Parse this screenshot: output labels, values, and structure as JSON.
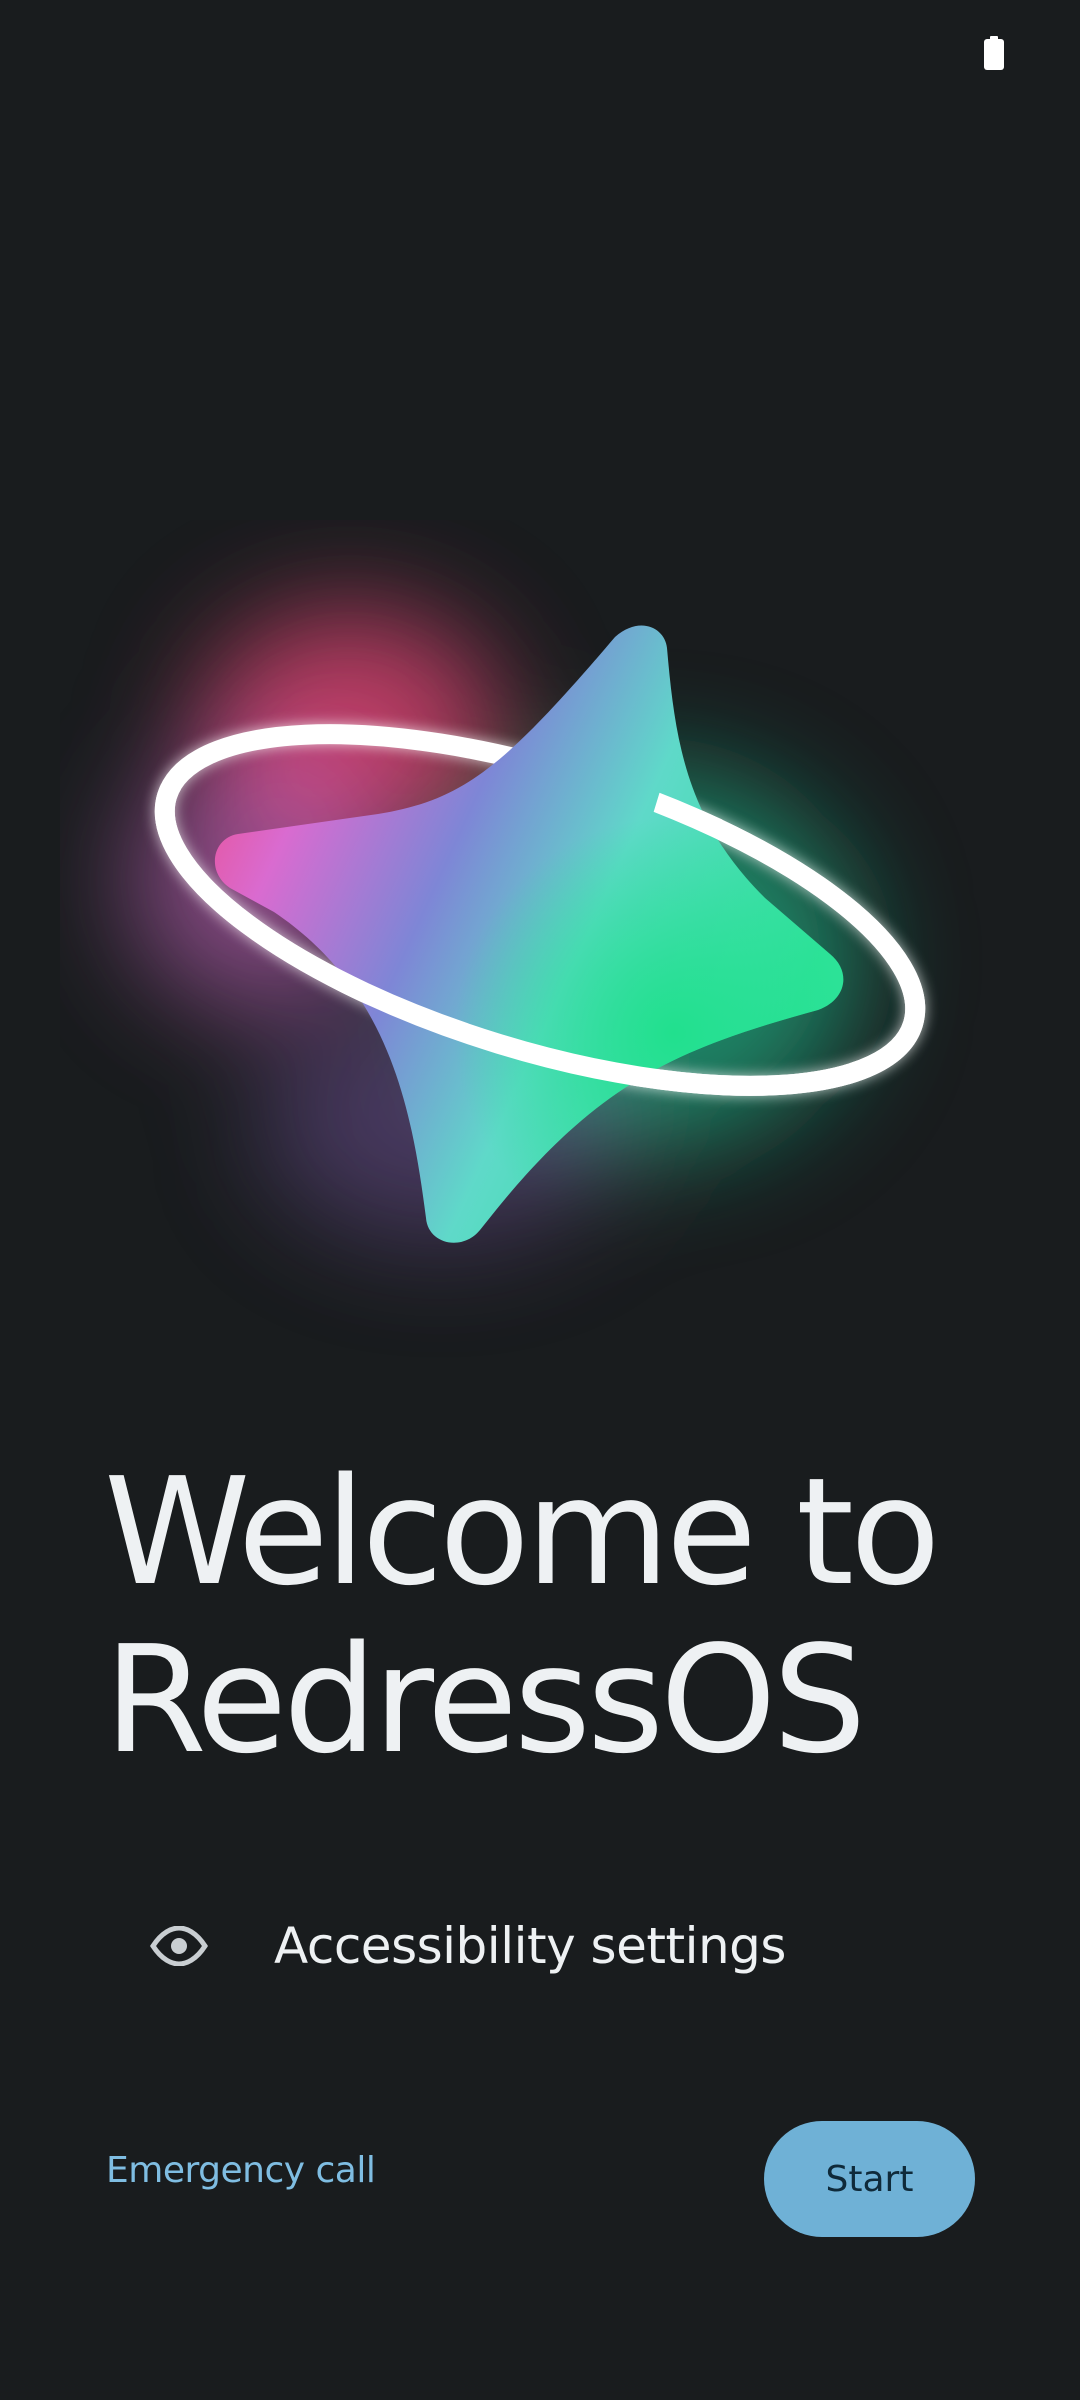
{
  "status_bar": {
    "battery_icon": "battery-full-icon"
  },
  "hero": {
    "illustration": "four-point-star-with-orbit-ring",
    "colors": {
      "pink": "#f0457a",
      "magenta": "#d96bd0",
      "violet": "#7e86d6",
      "teal": "#5fd9c9",
      "green": "#22e08f",
      "ring": "#ffffff"
    }
  },
  "welcome": {
    "line1": "Welcome to",
    "line2": "RedressOS"
  },
  "accessibility": {
    "icon": "eye-icon",
    "label": "Accessibility settings"
  },
  "footer": {
    "emergency_label": "Emergency call",
    "start_label": "Start"
  },
  "colors": {
    "background": "#191c1e",
    "text": "#eef1f3",
    "link": "#7fbde2",
    "button": "#6fb1d6",
    "button_text": "#0f2a3a"
  }
}
